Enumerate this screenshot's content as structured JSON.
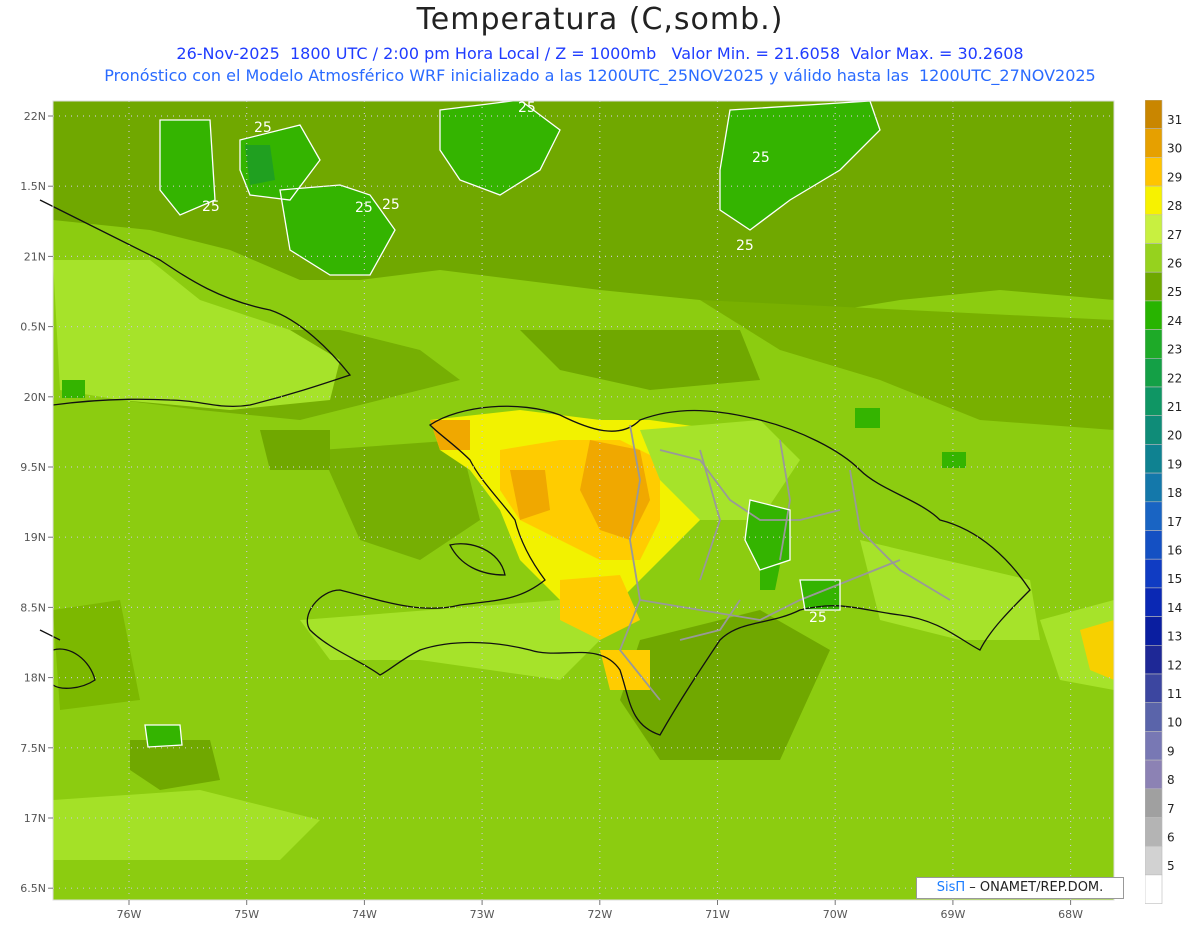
{
  "title": "Temperatura (C,somb.)",
  "subtitle_line1": "26-Nov-2025  1800 UTC / 2:00 pm Hora Local / Z = 1000mb   Valor Min. = 21.6058  Valor Max. = 30.2608",
  "subtitle_line2": "Pronóstico con el Modelo Atmosférico WRF inicializado a las 1200UTC_25NOV2025 y válido hasta las  1200UTC_27NOV2025",
  "credit": {
    "brand": "SisΠ",
    "text": " – ONAMET/REP.DOM."
  },
  "lat_ticks": [
    "22N",
    "1.5N",
    "21N",
    "0.5N",
    "20N",
    "9.5N",
    "19N",
    "8.5N",
    "18N",
    "7.5N",
    "17N",
    "6.5N"
  ],
  "lon_ticks": [
    "76W",
    "75W",
    "74W",
    "73W",
    "72W",
    "71W",
    "70W",
    "69W",
    "68W"
  ],
  "contour_label": "25",
  "colors": {
    "c25": "#70a800",
    "c26": "#8ccc10",
    "c27": "#a6e32a",
    "c28": "#f2f200",
    "c29": "#ffcc00",
    "c30": "#f0a800",
    "c31": "#d08a00",
    "c24": "#34b400",
    "c23": "#20a020",
    "c22": "#18a048"
  },
  "legend": [
    {
      "label": "31",
      "color": "#c98600"
    },
    {
      "label": "30",
      "color": "#e6a000"
    },
    {
      "label": "29",
      "color": "#ffc400"
    },
    {
      "label": "28",
      "color": "#f7f200"
    },
    {
      "label": "27",
      "color": "#c8f040"
    },
    {
      "label": "26",
      "color": "#96d21e"
    },
    {
      "label": "25",
      "color": "#6ea800"
    },
    {
      "label": "24",
      "color": "#28b400"
    },
    {
      "label": "23",
      "color": "#1eaa28"
    },
    {
      "label": "22",
      "color": "#14a046"
    },
    {
      "label": "21",
      "color": "#0f9664"
    },
    {
      "label": "20",
      "color": "#0f8c78"
    },
    {
      "label": "19",
      "color": "#0f8291"
    },
    {
      "label": "18",
      "color": "#1478aa"
    },
    {
      "label": "17",
      "color": "#1964c3"
    },
    {
      "label": "16",
      "color": "#1450c3"
    },
    {
      "label": "15",
      "color": "#103cc3"
    },
    {
      "label": "14",
      "color": "#0a28b4"
    },
    {
      "label": "13",
      "color": "#0a1ea0"
    },
    {
      "label": "12",
      "color": "#1e2896"
    },
    {
      "label": "11",
      "color": "#3c46a0"
    },
    {
      "label": "10",
      "color": "#5a64aa"
    },
    {
      "label": "9",
      "color": "#7878b4"
    },
    {
      "label": "8",
      "color": "#8c82b4"
    },
    {
      "label": "7",
      "color": "#a0a0a0"
    },
    {
      "label": "6",
      "color": "#b4b4b4"
    },
    {
      "label": "5",
      "color": "#d2d2d2"
    },
    {
      "label": "",
      "color": "#ffffff"
    }
  ]
}
